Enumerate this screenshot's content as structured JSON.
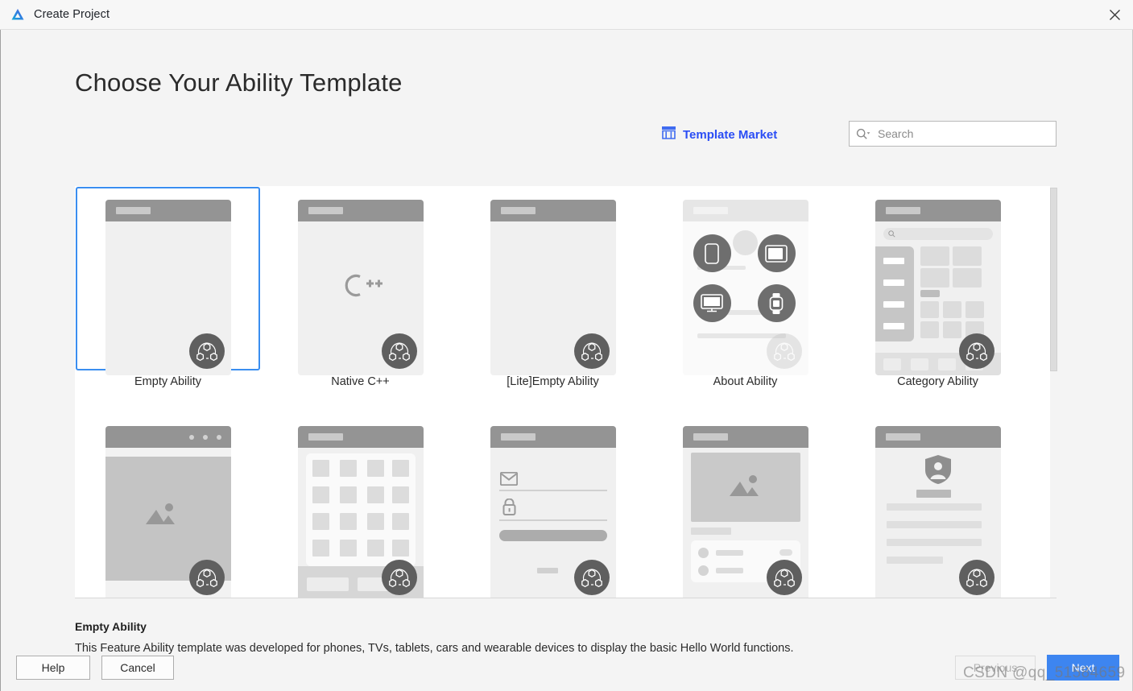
{
  "window": {
    "title": "Create Project",
    "logo_icon": "deveco-triangle-logo",
    "close_icon": "close-icon"
  },
  "page": {
    "heading": "Choose Your Ability Template"
  },
  "toolbar": {
    "market_label": "Template Market",
    "market_icon": "shop-icon",
    "search_icon": "search-dropdown-icon",
    "search_placeholder": "Search",
    "search_value": ""
  },
  "templates": [
    {
      "label": "Empty Ability",
      "thumb": "empty",
      "selected": true
    },
    {
      "label": "Native C++",
      "thumb": "cpp",
      "selected": false
    },
    {
      "label": "[Lite]Empty Ability",
      "thumb": "empty",
      "selected": false
    },
    {
      "label": "About Ability",
      "thumb": "about",
      "selected": false
    },
    {
      "label": "Category Ability",
      "thumb": "category",
      "selected": false
    },
    {
      "label": "",
      "thumb": "gallery",
      "selected": false
    },
    {
      "label": "",
      "thumb": "grid",
      "selected": false
    },
    {
      "label": "",
      "thumb": "login",
      "selected": false
    },
    {
      "label": "",
      "thumb": "imagelist",
      "selected": false
    },
    {
      "label": "",
      "thumb": "profile",
      "selected": false
    }
  ],
  "details": {
    "title": "Empty Ability",
    "description": "This Feature Ability template was developed for phones, TVs, tablets, cars and wearable devices to display the basic Hello World functions."
  },
  "footer": {
    "help_label": "Help",
    "cancel_label": "Cancel",
    "previous_label": "Previous",
    "next_label": "Next"
  },
  "watermark": {
    "text": "CSDN @qq_51584659"
  },
  "colors": {
    "accent_blue": "#3d85f0",
    "link_blue": "#2a4df5",
    "selection_border": "#3a8ef0",
    "panel_bg": "#ffffff",
    "dialog_bg": "#f4f4f4"
  }
}
